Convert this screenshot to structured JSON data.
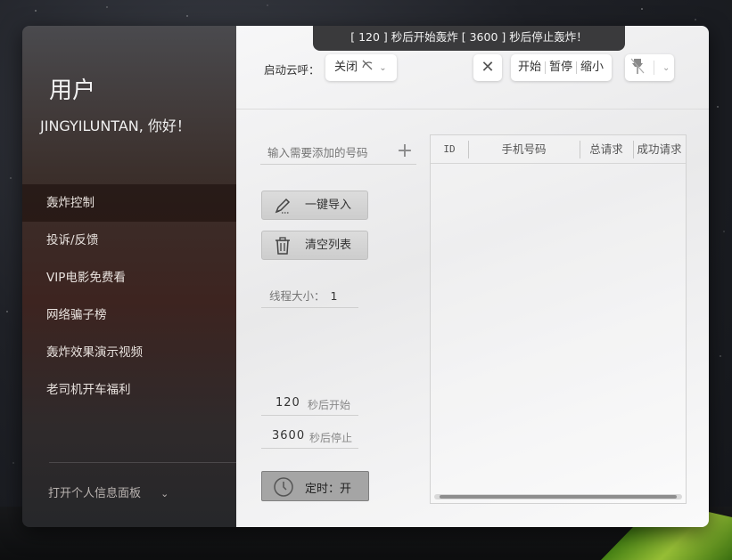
{
  "banner": {
    "text": "[ 120 ] 秒后开始轰炸   [ 3600 ] 秒后停止轰炸！"
  },
  "sidebar": {
    "title": "用户",
    "greeting": "JINGYILUNTAN, 你好！",
    "items": [
      {
        "label": "轰炸控制",
        "active": true
      },
      {
        "label": "投诉/反馈"
      },
      {
        "label": "VIP电影免费看"
      },
      {
        "label": "网络骗子榜"
      },
      {
        "label": "轰炸效果演示视频"
      },
      {
        "label": "老司机开车福利"
      }
    ],
    "profile_label": "打开个人信息面板"
  },
  "toolbar": {
    "cloud_label": "启动云呼：",
    "cloud_value": "关闭",
    "start_label": "开始",
    "pause_label": "暂停",
    "minimize_label": "缩小"
  },
  "form": {
    "add_placeholder": "输入需要添加的号码",
    "import_label": "一键导入",
    "clear_label": "清空列表",
    "thread_label": "线程大小：",
    "thread_value": "1",
    "start_seconds": "120",
    "start_suffix": "秒后开始",
    "stop_seconds": "3600",
    "stop_suffix": "秒后停止",
    "schedule_label": "定时：开"
  },
  "table": {
    "columns": [
      "ID",
      "手机号码",
      "总请求",
      "成功请求"
    ],
    "rows": []
  },
  "colors": {
    "banner_bg": "#3a3a3c",
    "active_nav_bg": "#1e0f0c"
  }
}
